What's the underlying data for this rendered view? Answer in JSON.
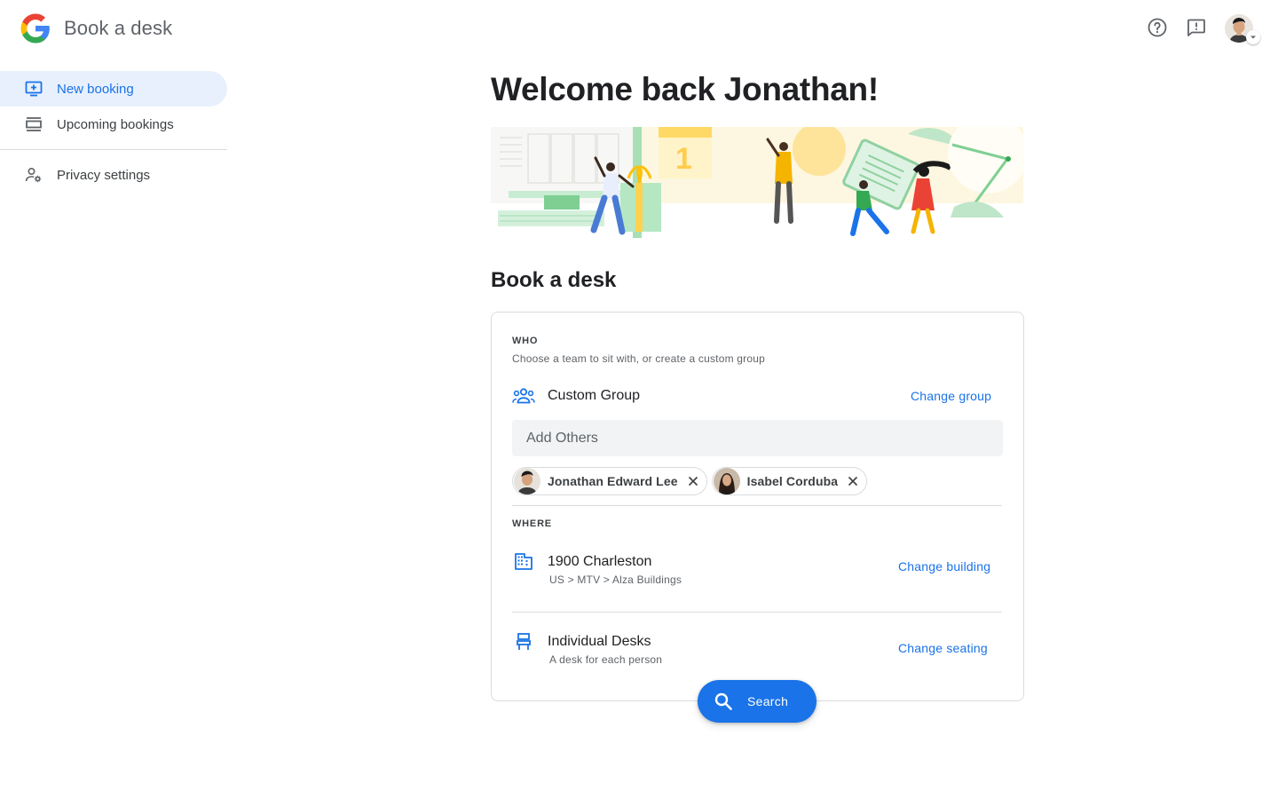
{
  "header": {
    "app_title": "Book a desk",
    "icons": [
      "google-logo",
      "help-icon",
      "feedback-icon",
      "account-avatar"
    ]
  },
  "sidebar": {
    "items": [
      {
        "label": "New booking",
        "icon": "add-to-screen-icon",
        "active": true
      },
      {
        "label": "Upcoming bookings",
        "icon": "list-icon",
        "active": false
      },
      {
        "label": "Privacy settings",
        "icon": "person-settings-icon",
        "active": false
      }
    ]
  },
  "main": {
    "welcome": "Welcome back Jonathan!",
    "banner_calendar_day": "1",
    "section_title": "Book a desk",
    "who": {
      "overline": "WHO",
      "helper": "Choose a team to sit with, or create a custom group",
      "group_name": "Custom Group",
      "change_label": "Change group",
      "add_placeholder": "Add Others",
      "chips": [
        {
          "name": "Jonathan Edward Lee"
        },
        {
          "name": "Isabel Corduba"
        }
      ]
    },
    "where": {
      "overline": "WHERE",
      "building": "1900 Charleston",
      "building_path": "US > MTV > Alza Buildings",
      "change_building_label": "Change building",
      "seating": "Individual Desks",
      "seating_sub": "A desk for each person",
      "change_seating_label": "Change seating"
    },
    "search_label": "Search"
  },
  "colors": {
    "accent": "#1a73e8",
    "active_nav_bg": "#e8f0fe",
    "text_primary": "#202124",
    "text_secondary": "#5f6368",
    "input_bg": "#f1f3f4"
  }
}
